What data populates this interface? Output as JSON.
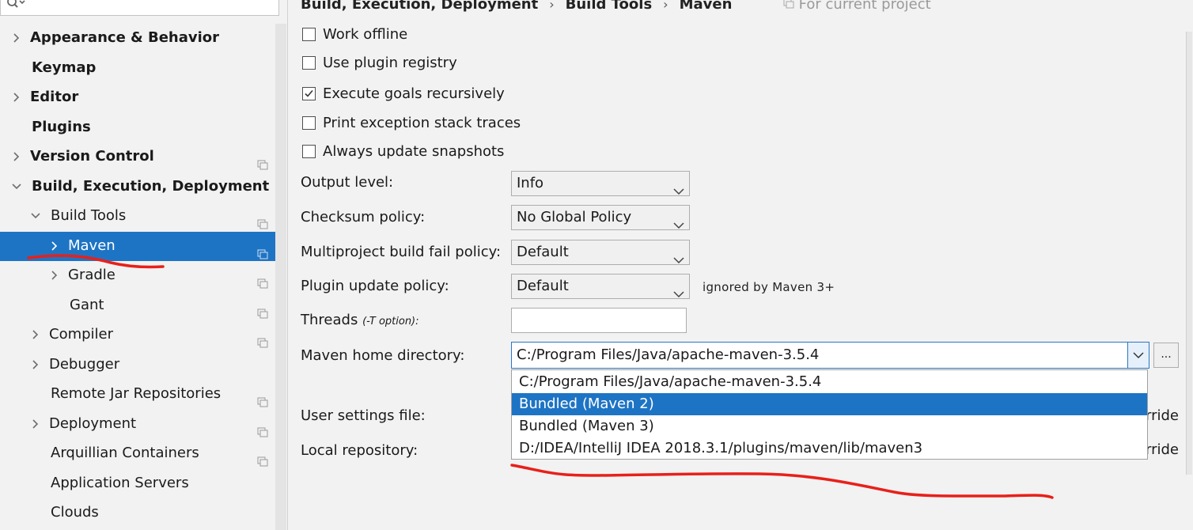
{
  "sidebar": {
    "items": [
      {
        "label": "Appearance & Behavior"
      },
      {
        "label": "Keymap"
      },
      {
        "label": "Editor"
      },
      {
        "label": "Plugins"
      },
      {
        "label": "Version Control"
      },
      {
        "label": "Build, Execution, Deployment"
      },
      {
        "label": "Build Tools"
      },
      {
        "label": "Maven"
      },
      {
        "label": "Gradle"
      },
      {
        "label": "Gant"
      },
      {
        "label": "Compiler"
      },
      {
        "label": "Debugger"
      },
      {
        "label": "Remote Jar Repositories"
      },
      {
        "label": "Deployment"
      },
      {
        "label": "Arquillian Containers"
      },
      {
        "label": "Application Servers"
      },
      {
        "label": "Clouds"
      }
    ]
  },
  "breadcrumb": {
    "parts": [
      "Build, Execution, Deployment",
      "Build Tools",
      "Maven"
    ],
    "scope": "For current project"
  },
  "checkboxes": [
    {
      "label": "Work offline",
      "checked": false
    },
    {
      "label": "Use plugin registry",
      "checked": false
    },
    {
      "label": "Execute goals recursively",
      "checked": true
    },
    {
      "label": "Print exception stack traces",
      "checked": false
    },
    {
      "label": "Always update snapshots",
      "checked": false
    }
  ],
  "form": {
    "output_level": {
      "label": "Output level:",
      "value": "Info"
    },
    "checksum_policy": {
      "label": "Checksum policy:",
      "value": "No Global Policy"
    },
    "multiproject_fail": {
      "label": "Multiproject build fail policy:",
      "value": "Default"
    },
    "plugin_update": {
      "label": "Plugin update policy:",
      "value": "Default",
      "note": "ignored by Maven 3+"
    },
    "threads": {
      "label": "Threads",
      "hint": "(-T option):",
      "value": ""
    },
    "maven_home": {
      "label": "Maven home directory:",
      "value": "C:/Program Files/Java/apache-maven-3.5.4",
      "browse": "..."
    },
    "user_settings": {
      "label": "User settings file:",
      "override_fragment": "rride"
    },
    "local_repo": {
      "label": "Local repository:",
      "override_fragment": "rride"
    }
  },
  "dropdown": {
    "options": [
      "C:/Program Files/Java/apache-maven-3.5.4",
      "Bundled (Maven 2)",
      "Bundled (Maven 3)",
      "D:/IDEA/IntelliJ IDEA 2018.3.1/plugins/maven/lib/maven3"
    ],
    "selected_index": 1
  },
  "colors": {
    "selection": "#1e74c4",
    "annotation": "#e8201a"
  }
}
